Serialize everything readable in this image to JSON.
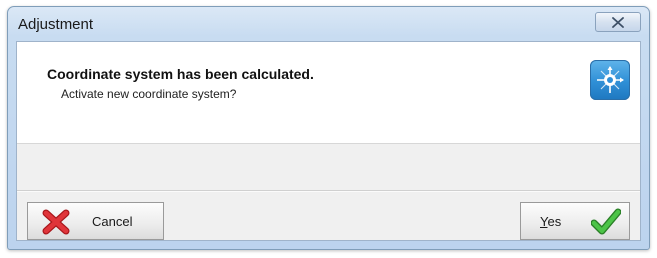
{
  "window": {
    "title": "Adjustment",
    "close_icon": "close-x-icon"
  },
  "message": {
    "title": "Coordinate system has been calculated.",
    "subtitle": "Activate new coordinate system?",
    "icon": "coordinate-system-icon",
    "icon_color": "#2f8fd6"
  },
  "buttons": {
    "cancel": {
      "label": "Cancel",
      "icon": "red-x-icon",
      "icon_color": "#d9262a"
    },
    "yes": {
      "label_mnemonic": "Y",
      "label_rest": "es",
      "icon": "green-check-icon",
      "icon_color": "#3da53a"
    }
  }
}
